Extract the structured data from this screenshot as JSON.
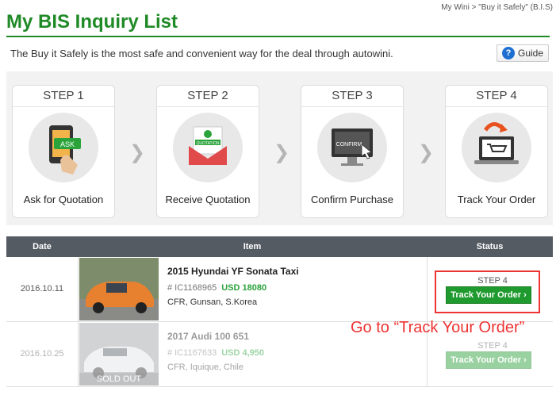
{
  "breadcrumb": "My Wini > \"Buy it Safely\" (B.I.S)",
  "page_title": "My BIS Inquiry List",
  "intro": "The Buy it Safely is the most safe and convenient way for the deal through autowini.",
  "guide": {
    "label": "Guide",
    "icon": "question-icon"
  },
  "steps": [
    {
      "num": "STEP 1",
      "label": "Ask for Quotation",
      "icon": "ask-tablet-icon"
    },
    {
      "num": "STEP 2",
      "label": "Receive Quotation",
      "icon": "quotation-envelope-icon"
    },
    {
      "num": "STEP 3",
      "label": "Confirm Purchase",
      "icon": "confirm-monitor-icon"
    },
    {
      "num": "STEP 4",
      "label": "Track Your Order",
      "icon": "cart-laptop-icon"
    }
  ],
  "chevron": "❯",
  "table": {
    "headers": [
      "Date",
      "Item",
      "Status"
    ],
    "rows": [
      {
        "date": "2016.10.11",
        "name": "2015 Hyundai YF Sonata Taxi",
        "ref": "# IC1168965",
        "price": "USD 18080",
        "location": "CFR, Gunsan, S.Korea",
        "step": "STEP 4",
        "button": "Track Your Order  ›",
        "sold": ""
      },
      {
        "date": "2016.10.25",
        "name": "2017 Audi 100 651",
        "ref": "# IC1167633",
        "price": "USD 4,950",
        "location": "CFR, Iquique, Chile",
        "step": "STEP 4",
        "button": "Track Your Order  ›",
        "sold": "SOLD OUT"
      }
    ]
  },
  "annotation": "Go to “Track Your Order”",
  "colors": {
    "brand_green": "#1f8a26",
    "header_gray": "#555b63",
    "highlight_red": "#e33333"
  }
}
